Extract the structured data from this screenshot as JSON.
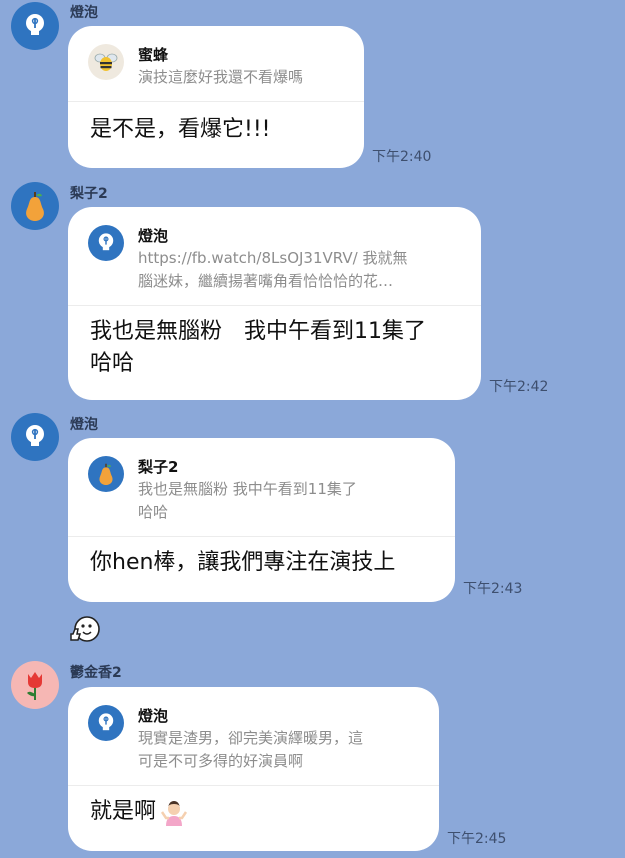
{
  "messages": [
    {
      "sender": "燈泡",
      "quote": {
        "name": "蜜蜂",
        "lines": [
          "演技這麼好我還不看爆嗎"
        ]
      },
      "text": [
        "是不是，看爆它!!!"
      ],
      "time": "下午2:40"
    },
    {
      "sender": "梨子2",
      "quote": {
        "name": "燈泡",
        "lines": [
          "https://fb.watch/8LsOJ31VRV/ 我就無",
          "腦迷妹，繼續揚著嘴角看恰恰恰的花…"
        ]
      },
      "text": [
        "我也是無腦粉　我中午看到11集了",
        "哈哈"
      ],
      "time": "下午2:42"
    },
    {
      "sender": "燈泡",
      "quote": {
        "name": "梨子2",
        "lines": [
          "我也是無腦粉 我中午看到11集了",
          "哈哈"
        ]
      },
      "text": [
        "你hen棒，讓我們專注在演技上"
      ],
      "time": "下午2:43"
    },
    {
      "sender": "鬱金香2",
      "quote": {
        "name": "燈泡",
        "lines": [
          "現實是渣男，卻完美演繹暖男，這",
          "可是不可多得的好演員啊"
        ]
      },
      "text": [
        "就是啊"
      ],
      "time": "下午2:45"
    }
  ],
  "colors": {
    "background": "#8ba8d9",
    "avatar_blue": "#2f74c0",
    "avatar_pink": "#f6b7b4"
  },
  "icons": [
    "bulb-icon",
    "pear-icon",
    "bee-icon",
    "tulip-icon",
    "thumbs-up-sticker-icon",
    "shrug-emoji-icon"
  ]
}
